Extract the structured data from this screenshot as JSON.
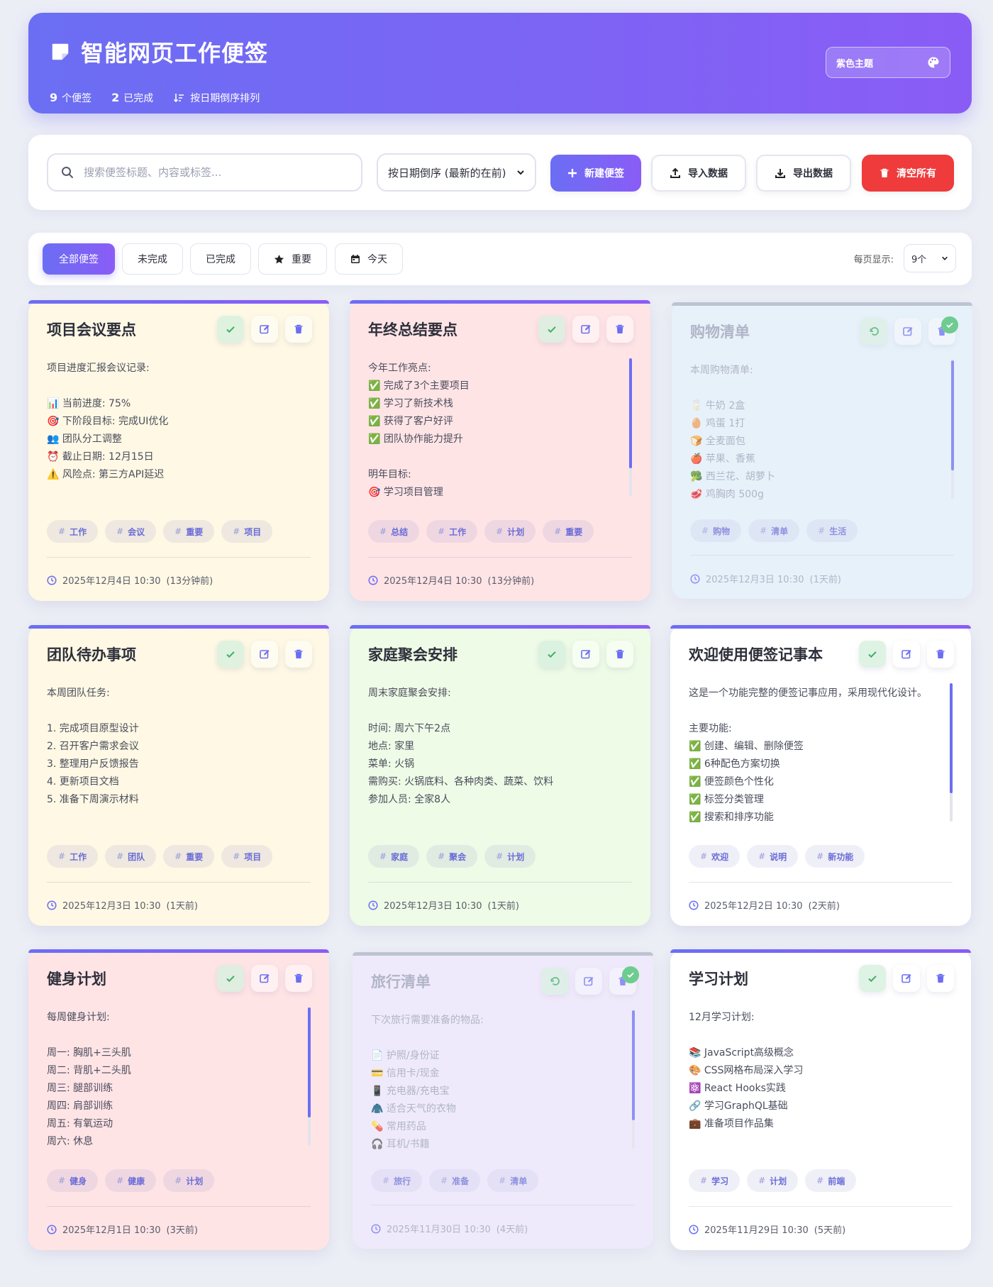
{
  "header": {
    "title": "智能网页工作便签",
    "count_num": "9",
    "count_label": "个便签",
    "done_num": "2",
    "done_label": "已完成",
    "sort_label": "按日期倒序排列",
    "theme_label": "紫色主题"
  },
  "toolbar": {
    "search_placeholder": "搜索便签标题、内容或标签...",
    "sort_value": "按日期倒序 (最新的在前)",
    "new_label": "新建便签",
    "import_label": "导入数据",
    "export_label": "导出数据",
    "clear_label": "清空所有"
  },
  "filters": {
    "all": "全部便签",
    "undone": "未完成",
    "done": "已完成",
    "important": "重要",
    "today": "今天",
    "perpage_label": "每页显示:",
    "perpage_value": "9个"
  },
  "colors": {
    "accent": "#6b6ef3",
    "accent2": "#8a5cf6",
    "danger": "#ef3b3b",
    "check": "#3fc06b",
    "yellow": "#fff8e4",
    "pink": "#ffe4e6",
    "blue": "#e6f3fc",
    "green": "#eefbe6",
    "white": "#ffffff",
    "purple": "#f1e9fd"
  },
  "cards": [
    {
      "title": "项目会议要点",
      "content": "项目进度汇报会议记录:\n\n📊 当前进度: 75%\n🎯 下阶段目标: 完成UI优化\n👥 团队分工调整\n⏰ 截止日期: 12月15日\n⚠️ 风险点: 第三方API延迟",
      "tags": [
        "工作",
        "会议",
        "重要",
        "项目"
      ],
      "date": "2025年12月4日 10:30",
      "ago": "(13分钟前)"
    },
    {
      "title": "年终总结要点",
      "content": "今年工作亮点:\n✅ 完成了3个主要项目\n✅ 学习了新技术栈\n✅ 获得了客户好评\n✅ 团队协作能力提升\n\n明年目标:\n🎯 学习项目管理",
      "tags": [
        "总结",
        "工作",
        "计划",
        "重要"
      ],
      "date": "2025年12月4日 10:30",
      "ago": "(13分钟前)"
    },
    {
      "title": "购物清单",
      "content": "本周购物清单:\n\n🥛 牛奶 2盒\n🥚 鸡蛋 1打\n🍞 全麦面包\n🍎 苹果、香蕉\n🥦 西兰花、胡萝卜\n🥩 鸡胸肉 500g",
      "tags": [
        "购物",
        "清单",
        "生活"
      ],
      "date": "2025年12月3日 10:30",
      "ago": "(1天前)"
    },
    {
      "title": "团队待办事项",
      "content": "本周团队任务:\n\n1. 完成项目原型设计\n2. 召开客户需求会议\n3. 整理用户反馈报告\n4. 更新项目文档\n5. 准备下周演示材料",
      "tags": [
        "工作",
        "团队",
        "重要",
        "项目"
      ],
      "date": "2025年12月3日 10:30",
      "ago": "(1天前)"
    },
    {
      "title": "家庭聚会安排",
      "content": "周末家庭聚会安排:\n\n时间: 周六下午2点\n地点: 家里\n菜单: 火锅\n需购买: 火锅底料、各种肉类、蔬菜、饮料\n参加人员: 全家8人",
      "tags": [
        "家庭",
        "聚会",
        "计划"
      ],
      "date": "2025年12月3日 10:30",
      "ago": "(1天前)"
    },
    {
      "title": "欢迎使用便签记事本",
      "content": "这是一个功能完整的便签记事应用，采用现代化设计。\n\n主要功能:\n✅ 创建、编辑、删除便签\n✅ 6种配色方案切换\n✅ 便签颜色个性化\n✅ 标签分类管理\n✅ 搜索和排序功能",
      "tags": [
        "欢迎",
        "说明",
        "新功能"
      ],
      "date": "2025年12月2日 10:30",
      "ago": "(2天前)"
    },
    {
      "title": "健身计划",
      "content": "每周健身计划:\n\n周一: 胸肌+三头肌\n周二: 背肌+二头肌\n周三: 腿部训练\n周四: 肩部训练\n周五: 有氧运动\n周六: 休息",
      "tags": [
        "健身",
        "健康",
        "计划"
      ],
      "date": "2025年12月1日 10:30",
      "ago": "(3天前)"
    },
    {
      "title": "旅行清单",
      "content": "下次旅行需要准备的物品:\n\n📄 护照/身份证\n💳 信用卡/现金\n📱 充电器/充电宝\n🧥 适合天气的衣物\n💊 常用药品\n🎧 耳机/书籍",
      "tags": [
        "旅行",
        "准备",
        "清单"
      ],
      "date": "2025年11月30日 10:30",
      "ago": "(4天前)"
    },
    {
      "title": "学习计划",
      "content": "12月学习计划:\n\n📚 JavaScript高级概念\n🎨 CSS网格布局深入学习\n⚛️ React Hooks实践\n🔗 学习GraphQL基础\n💼 准备项目作品集",
      "tags": [
        "学习",
        "计划",
        "前端"
      ],
      "date": "2025年11月29日 10:30",
      "ago": "(5天前)"
    }
  ]
}
